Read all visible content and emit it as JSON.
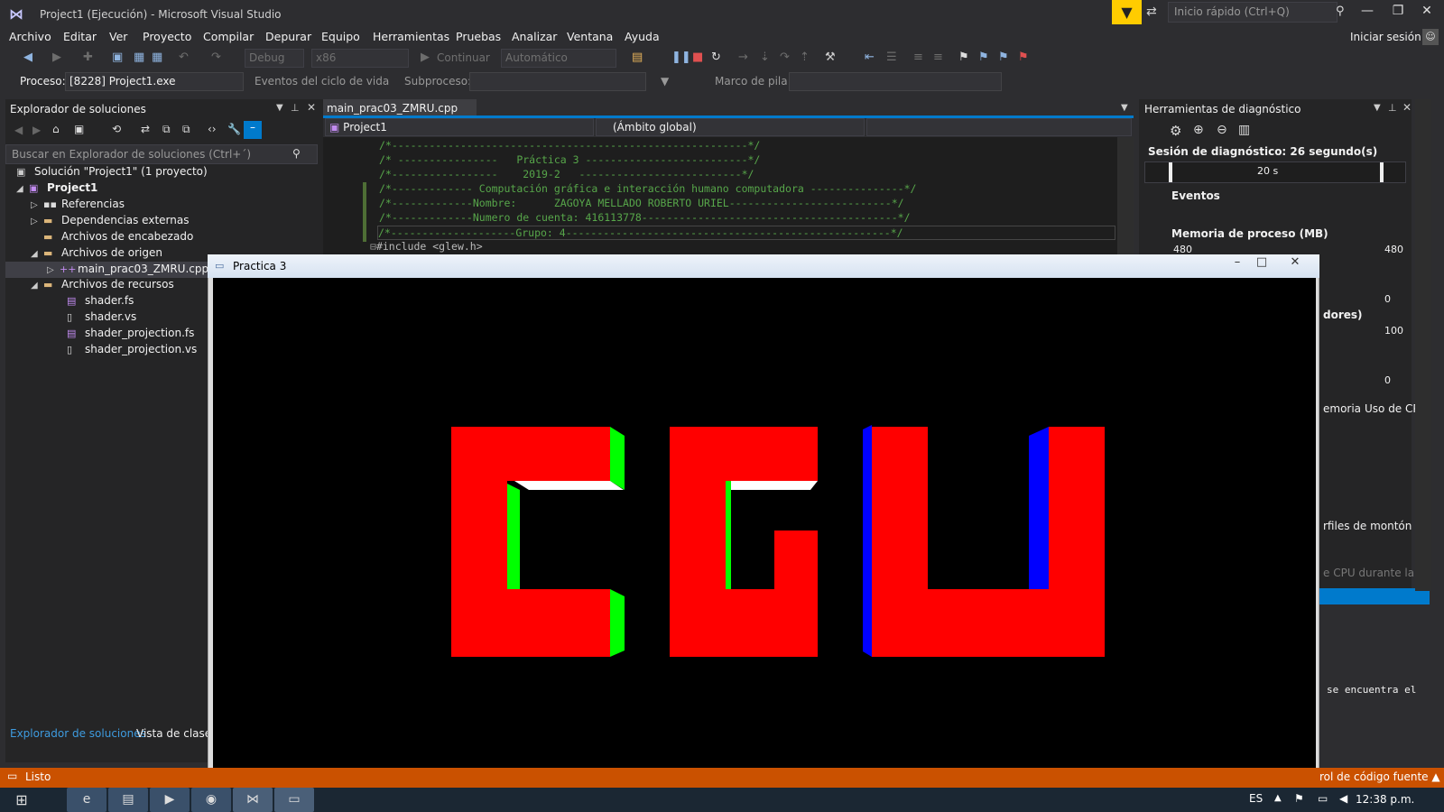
{
  "window": {
    "title": "Project1 (Ejecución) - Microsoft Visual Studio",
    "quick_launch_placeholder": "Inicio rápido (Ctrl+Q)",
    "sign_in": "Iniciar sesión"
  },
  "menu": [
    "Archivo",
    "Editar",
    "Ver",
    "Proyecto",
    "Compilar",
    "Depurar",
    "Equipo",
    "Herramientas",
    "Pruebas",
    "Analizar",
    "Ventana",
    "Ayuda"
  ],
  "toolbar": {
    "config": "Debug",
    "platform": "x86",
    "continue": "Continuar",
    "automatic": "Automático"
  },
  "debugbar": {
    "process_label": "Proceso:",
    "process_value": "[8228] Project1.exe",
    "lifecycle": "Eventos del ciclo de vida",
    "thread": "Subproceso:",
    "stack_frame": "Marco de pila:"
  },
  "solution_explorer": {
    "title": "Explorador de soluciones",
    "search_placeholder": "Buscar en Explorador de soluciones (Ctrl+´)",
    "tree": [
      {
        "label": "Solución \"Project1\"  (1 proyecto)",
        "icon": "solution-icon"
      },
      {
        "label": "Project1",
        "icon": "project-icon"
      },
      {
        "label": "Referencias",
        "icon": "references-icon"
      },
      {
        "label": "Dependencias externas",
        "icon": "folder-icon"
      },
      {
        "label": "Archivos de encabezado",
        "icon": "folder-icon"
      },
      {
        "label": "Archivos de origen",
        "icon": "folder-icon"
      },
      {
        "label": "main_prac03_ZMRU.cpp",
        "icon": "cpp-file-icon"
      },
      {
        "label": "Archivos de recursos",
        "icon": "folder-icon"
      },
      {
        "label": "shader.fs",
        "icon": "file-icon"
      },
      {
        "label": "shader.vs",
        "icon": "file-icon"
      },
      {
        "label": "shader_projection.fs",
        "icon": "file-icon"
      },
      {
        "label": "shader_projection.vs",
        "icon": "file-icon"
      }
    ],
    "tabs": [
      "Explorador de soluciones",
      "Vista de clases"
    ]
  },
  "editor": {
    "tab_label": "main_prac03_ZMRU.cpp",
    "nav_project": "Project1",
    "nav_scope": "(Ámbito global)",
    "code_lines": [
      "/*---------------------------------------------------------*/",
      "/* ----------------   Práctica 3 --------------------------*/",
      "/*-----------------    2019-2   --------------------------*/",
      "/*------------- Computación gráfica e interacción humano computadora ---------------*/",
      "/*-------------Nombre:      ZAGOYA MELLADO ROBERTO URIEL--------------------------*/",
      "/*-------------Numero de cuenta: 416113778-----------------------------------------*/",
      "/*--------------------Grupo: 4----------------------------------------------------*/",
      "#include <glew.h>"
    ]
  },
  "diagnostics": {
    "title": "Herramientas de diagnóstico",
    "session": "Sesión de diagnóstico: 26 segundo(s)",
    "timeline_tick": "20 s",
    "events": "Eventos",
    "memory": "Memoria de proceso (MB)",
    "mem_max": "480",
    "mem_max_right": "480",
    "mem_min": "0",
    "cpu_partial": "dores)",
    "cpu_max": "100",
    "cpu_min": "0",
    "tabs_partial": "emoria",
    "cpu_tab": "Uso de CPU",
    "heap_partial": "rfiles de montón (a",
    "cpu_during_partial": "e CPU durante la c",
    "output_partial": "se encuentra el"
  },
  "gl_window": {
    "title": "Practica 3",
    "letters_colors": {
      "front": "#ff0000",
      "side_green": "#00ff00",
      "side_blue": "#0000ff",
      "top": "#ffffff",
      "bottom": "#ff00ff"
    }
  },
  "status": {
    "text": "Listo",
    "scc": "rol de código fuente"
  },
  "taskbar": {
    "lang": "ES",
    "clock": "12:38 p.m."
  }
}
